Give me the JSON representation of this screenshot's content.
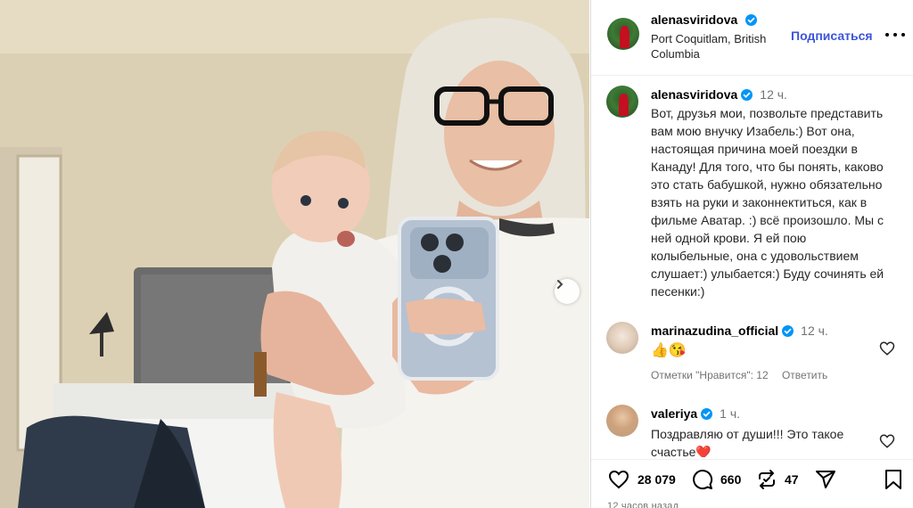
{
  "post": {
    "username": "alenasviridova",
    "location": "Port Coquitlam, British Columbia",
    "follow_label": "Подписаться",
    "more_icon": "more-horizontal-icon",
    "caption_time": "12 ч.",
    "caption": "Вот, друзья мои, позвольте представить вам мою внучку Изабель:) Вот она, настоящая причина моей поездки в Канаду!  Для того, что бы понять, каково это стать бабушкой, нужно обязательно взять на руки и законнектиться, как в фильме Аватар. :) всё произошло. Мы с ней одной крови. Я ей пою колыбельные, она с удовольствием слушает:) улыбается:) Буду сочинять ей песенки:)"
  },
  "comments": [
    {
      "username": "marinazudina_official",
      "time": "12 ч.",
      "text": "👍😘",
      "likes_label": "Отметки \"Нравится\": 12",
      "reply_label": "Ответить"
    },
    {
      "username": "valeriya",
      "time": "1 ч.",
      "text": "Поздравляю от души!!! Это такое счастье❤️"
    }
  ],
  "actions": {
    "likes": "28 079",
    "comments": "660",
    "reposts": "47"
  },
  "posted_ago": "12 часов назад",
  "colors": {
    "accent": "#3d54d9",
    "verified": "#0095f6",
    "secondary_text": "#737373"
  }
}
